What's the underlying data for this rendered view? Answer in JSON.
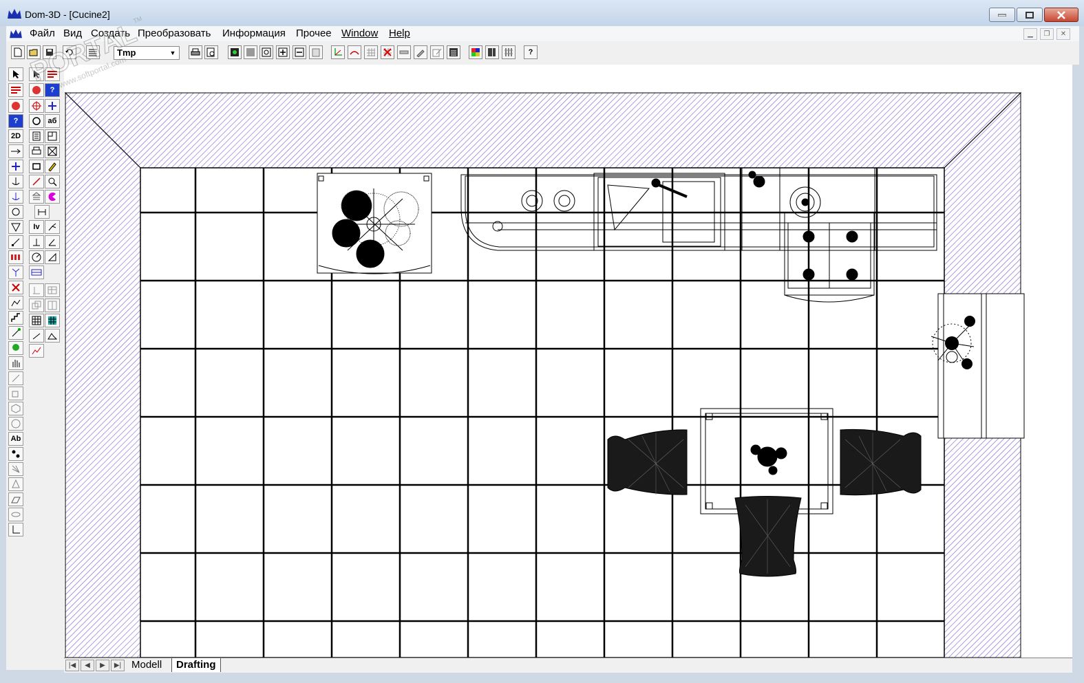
{
  "window": {
    "title": "Dom-3D - [Cucine2]",
    "controls": [
      "minimize",
      "maximize",
      "close"
    ]
  },
  "menu": {
    "items": [
      "Файл",
      "Вид",
      "Создать",
      "Преобразовать",
      "Информация",
      "Прочее",
      "Window",
      "Help"
    ]
  },
  "toolbar": {
    "layer_value": "Tmp",
    "help_label": "?"
  },
  "palette": {
    "col1_labels": [
      "2D",
      "Ab"
    ],
    "col2_labels": [
      "аб",
      "Iv"
    ],
    "help_label": "?"
  },
  "tabs": {
    "items": [
      "Modell",
      "Drafting"
    ],
    "active": "Drafting"
  },
  "watermark": {
    "text": "PORTAL",
    "sub": "www.softportal.com",
    "mark": "TM"
  },
  "colors": {
    "hatch": "#7a5ad0",
    "titlebar": "#c4d5ea",
    "close_button": "#c74630"
  }
}
